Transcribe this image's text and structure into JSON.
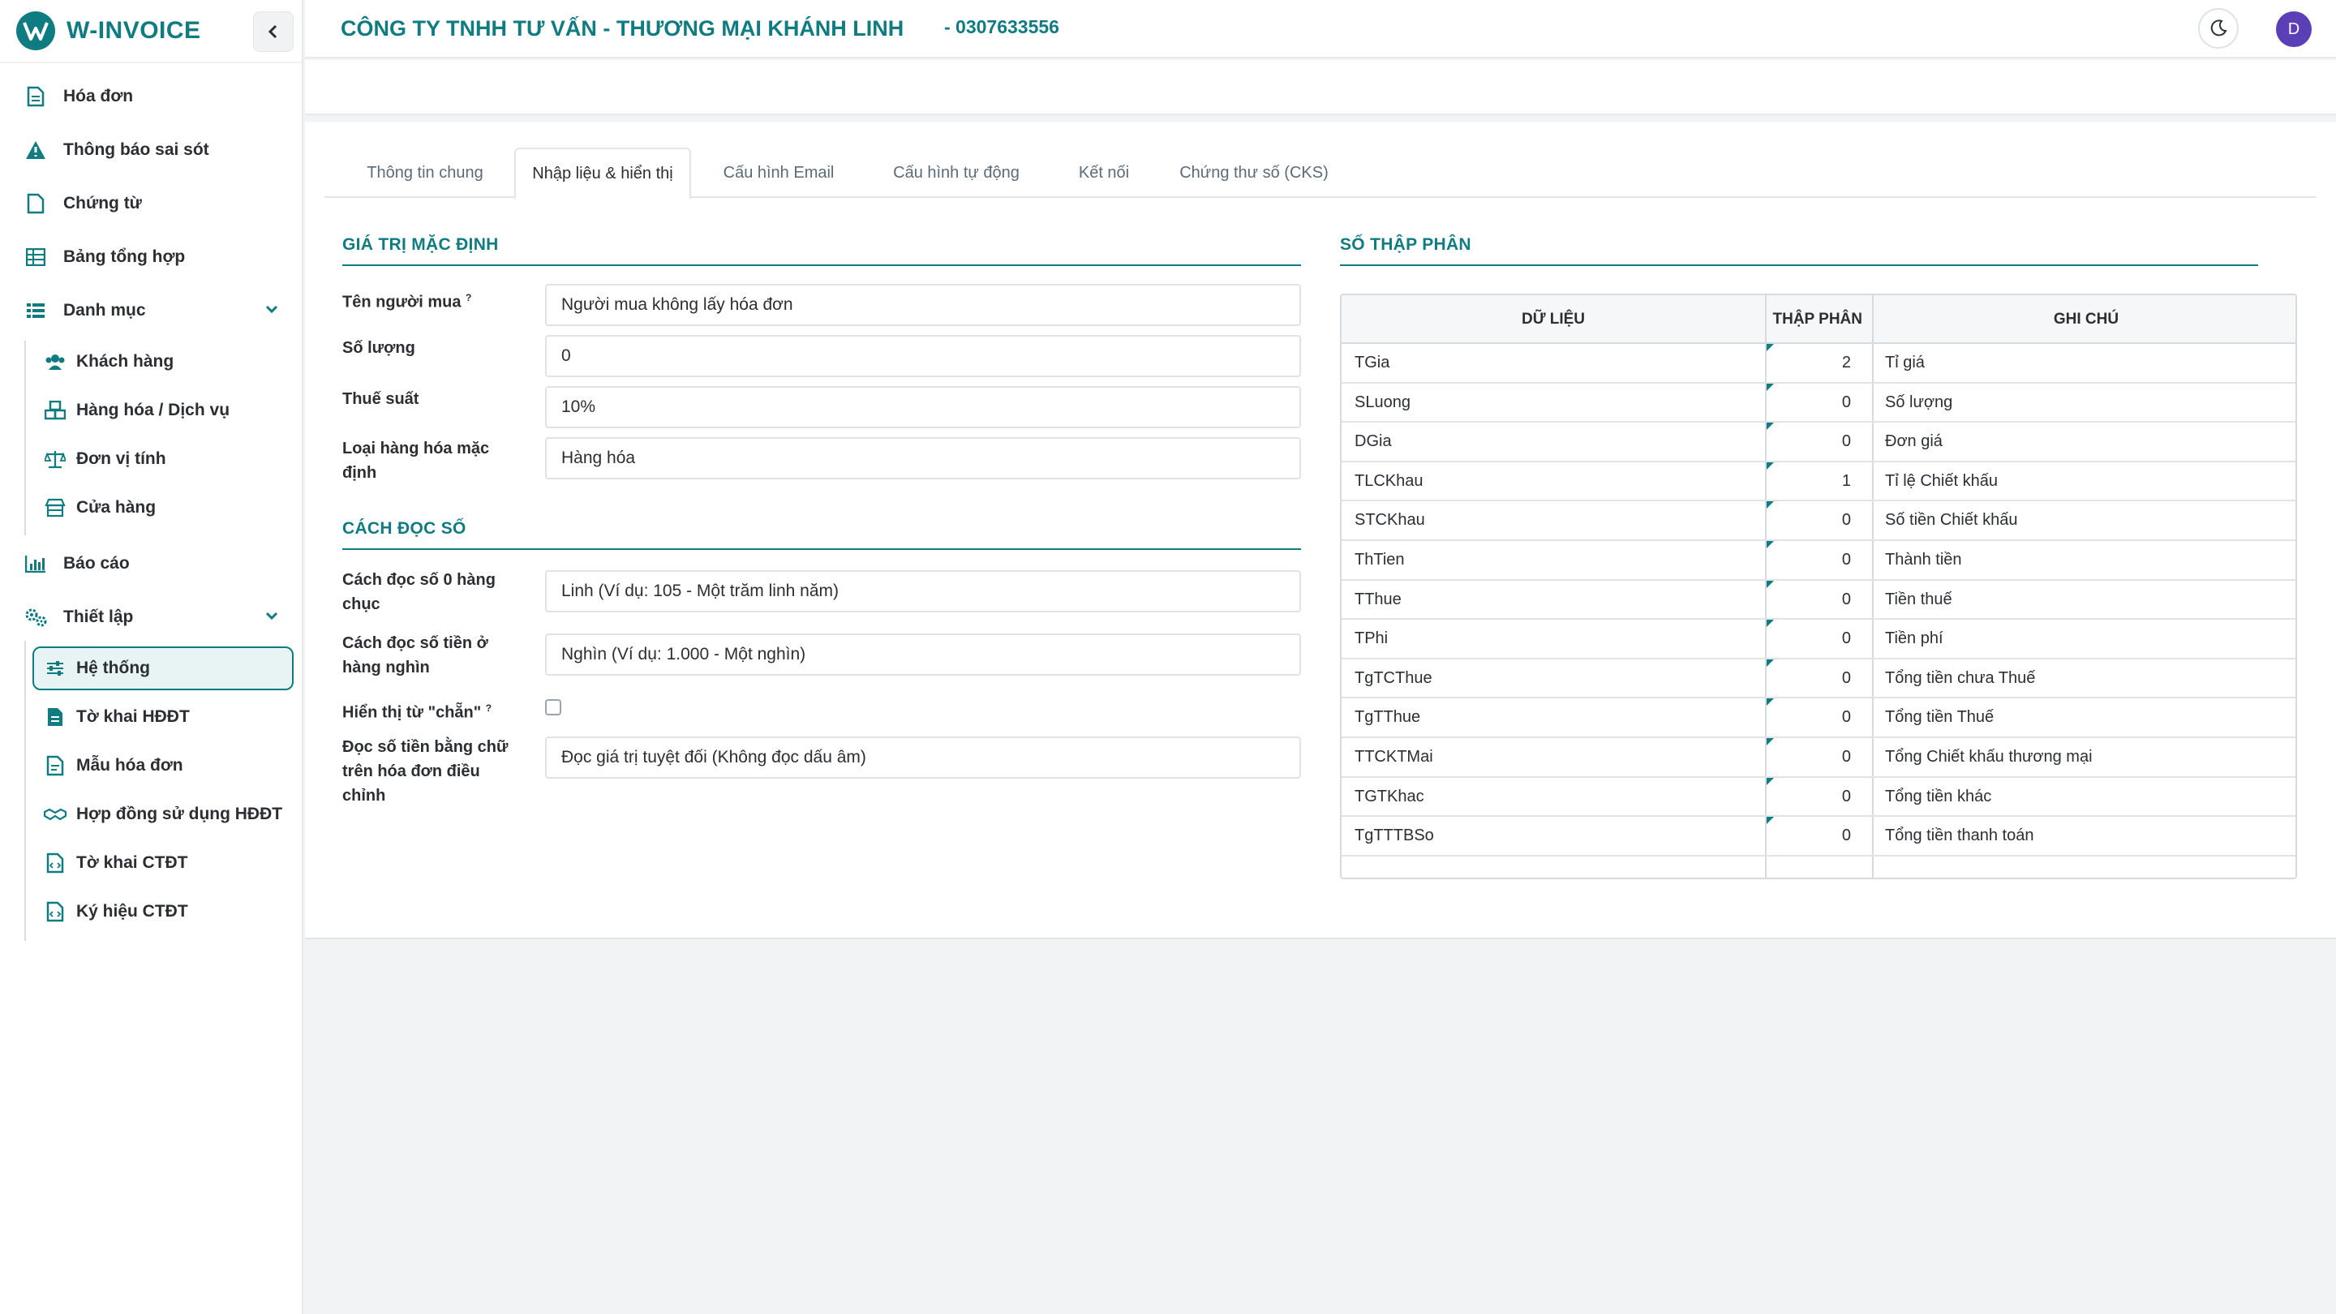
{
  "brand": {
    "name": "W-INVOICE"
  },
  "header": {
    "company": "CÔNG TY TNHH TƯ VẤN - THƯƠNG MẠI KHÁNH LINH",
    "phone": "- 0307633556",
    "avatar_letter": "D"
  },
  "sidebar": {
    "items": [
      {
        "label": "Hóa đơn",
        "icon": "file-invoice-icon"
      },
      {
        "label": "Thông báo sai sót",
        "icon": "warning-icon"
      },
      {
        "label": "Chứng từ",
        "icon": "file-icon"
      },
      {
        "label": "Bảng tổng hợp",
        "icon": "table-icon"
      },
      {
        "label": "Danh mục",
        "icon": "list-icon"
      },
      {
        "label": "Khách hàng",
        "icon": "users-icon"
      },
      {
        "label": "Hàng hóa / Dịch vụ",
        "icon": "boxes-icon"
      },
      {
        "label": "Đơn vị tính",
        "icon": "scale-icon"
      },
      {
        "label": "Cửa hàng",
        "icon": "store-icon"
      },
      {
        "label": "Báo cáo",
        "icon": "chart-icon"
      },
      {
        "label": "Thiết lập",
        "icon": "cogs-icon"
      },
      {
        "label": "Hệ thống",
        "icon": "sliders-icon"
      },
      {
        "label": "Tờ khai HĐĐT",
        "icon": "file-text-icon"
      },
      {
        "label": "Mẫu hóa đơn",
        "icon": "file-alt-icon"
      },
      {
        "label": "Hợp đồng sử dụng HĐĐT",
        "icon": "handshake-icon"
      },
      {
        "label": "Tờ khai CTĐT",
        "icon": "file-code-icon"
      },
      {
        "label": "Ký hiệu CTĐT",
        "icon": "file-code-icon"
      }
    ]
  },
  "tabs": [
    {
      "label": "Thông tin chung"
    },
    {
      "label": "Nhập liệu & hiển thị"
    },
    {
      "label": "Cấu hình Email"
    },
    {
      "label": "Cấu hình tự động"
    },
    {
      "label": "Kết nối"
    },
    {
      "label": "Chứng thư số (CKS)"
    }
  ],
  "defaults": {
    "title": "GIÁ TRỊ MẶC ĐỊNH",
    "buyer_label": "Tên người mua",
    "buyer_value": "Người mua không lấy hóa đơn",
    "qty_label": "Số lượng",
    "qty_value": "0",
    "tax_label": "Thuế suất",
    "tax_value": "10%",
    "type_label": "Loại hàng hóa mặc định",
    "type_value": "Hàng hóa",
    "help_mark": "?"
  },
  "reading": {
    "title": "CÁCH ĐỌC SỐ",
    "zero_label": "Cách đọc số 0 hàng chục",
    "zero_value": "Linh (Ví dụ: 105 - Một trăm linh năm)",
    "thousand_label": "Cách đọc số tiền ở hàng nghìn",
    "thousand_value": "Nghìn (Ví dụ: 1.000 - Một nghìn)",
    "even_label": "Hiển thị từ \"chẵn\"",
    "adjust_label": "Đọc số tiền bằng chữ trên hóa đơn điều chỉnh",
    "adjust_value": "Đọc giá trị tuyệt đối (Không đọc dấu âm)"
  },
  "decimals": {
    "title": "SỐ THẬP PHÂN",
    "columns": [
      "DỮ LIỆU",
      "THẬP PHÂN",
      "GHI CHÚ"
    ],
    "rows": [
      {
        "key": "TGia",
        "value": "2",
        "note": "Tỉ giá"
      },
      {
        "key": "SLuong",
        "value": "0",
        "note": "Số lượng"
      },
      {
        "key": "DGia",
        "value": "0",
        "note": "Đơn giá"
      },
      {
        "key": "TLCKhau",
        "value": "1",
        "note": "Tỉ lệ Chiết khấu"
      },
      {
        "key": "STCKhau",
        "value": "0",
        "note": "Số tiền Chiết khấu"
      },
      {
        "key": "ThTien",
        "value": "0",
        "note": "Thành tiền"
      },
      {
        "key": "TThue",
        "value": "0",
        "note": "Tiền thuế"
      },
      {
        "key": "TPhi",
        "value": "0",
        "note": "Tiền phí"
      },
      {
        "key": "TgTCThue",
        "value": "0",
        "note": "Tổng tiền chưa Thuế"
      },
      {
        "key": "TgTThue",
        "value": "0",
        "note": "Tổng tiền Thuế"
      },
      {
        "key": "TTCKTMai",
        "value": "0",
        "note": "Tổng Chiết khấu thương mại"
      },
      {
        "key": "TGTKhac",
        "value": "0",
        "note": "Tổng tiền khác"
      },
      {
        "key": "TgTTTBSo",
        "value": "0",
        "note": "Tổng tiền thanh toán"
      }
    ]
  }
}
